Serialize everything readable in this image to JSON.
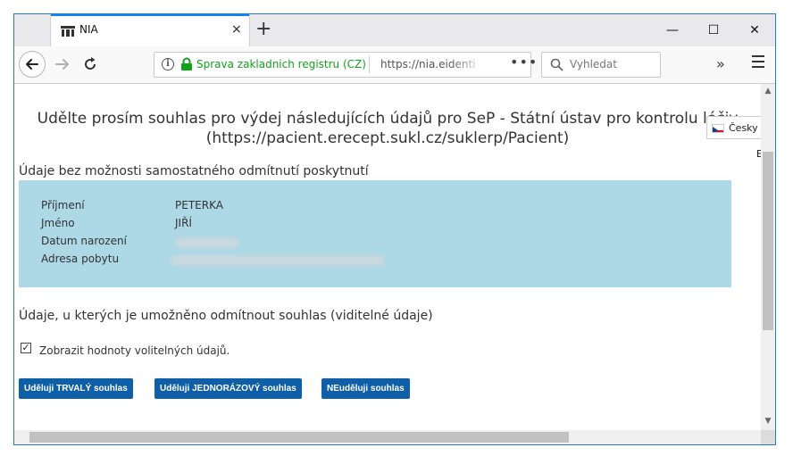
{
  "browser": {
    "tab_title": "NIA",
    "tab_close": "×",
    "new_tab": "+",
    "window_controls": [
      "—",
      "☐",
      "✕"
    ],
    "cert_label": "Sprava zakladnich registru (CZ)",
    "url": "https://nia.eidenti",
    "page_actions": "•••",
    "search_placeholder": "Vyhledat",
    "overflow": "»"
  },
  "page": {
    "heading_line1": "Udělte prosím souhlas pro výdej následujících údajů pro SeP - Státní ústav pro kontrolu léčiv",
    "heading_line2": "(https://pacient.erecept.sukl.cz/suklerp/Pacient)",
    "language_label": "Česky",
    "language_tail": "E",
    "section_required": "Údaje bez možnosti samostatného odmítnutí poskytnutí",
    "fields": [
      {
        "label": "Příjmení",
        "value": "PETERKA"
      },
      {
        "label": "Jméno",
        "value": "JIŘÍ"
      },
      {
        "label": "Datum narození",
        "value": ""
      },
      {
        "label": "Adresa pobytu",
        "value": ""
      }
    ],
    "section_optional": "Údaje, u kterých je umožněno odmítnout souhlas (viditelné údaje)",
    "checkbox_checked": "☑",
    "checkbox_label": "Zobrazit hodnoty volitelných údajů.",
    "buttons": {
      "permanent": "Uděluji TRVALÝ souhlas",
      "one_time": "Uděluji JEDNORÁZOVÝ souhlas",
      "deny": "NEuděluji souhlas"
    }
  },
  "colors": {
    "panel": "#add8e6",
    "button": "#0f5fa8",
    "tab_accent": "#0a84ff",
    "cert_green": "#12a31a"
  }
}
